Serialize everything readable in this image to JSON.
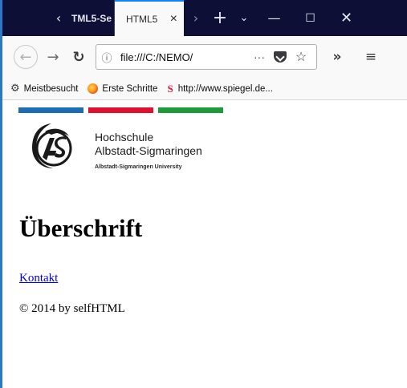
{
  "browser": {
    "tabs": [
      {
        "title": "TML5-Se",
        "active": false
      },
      {
        "title": "HTML5",
        "active": true
      }
    ],
    "url": "file:///C:/NEMO/",
    "bookmarks": [
      {
        "label": "Meistbesucht",
        "icon": "gear-icon"
      },
      {
        "label": "Erste Schritte",
        "icon": "firefox-icon"
      },
      {
        "label": "http://www.spiegel.de...",
        "icon": "spiegel-icon"
      }
    ],
    "icons": {
      "tab_scroll_left": "‹",
      "tab_scroll_right": "›",
      "new_tab": "+",
      "tab_list": "⌄",
      "close_tab": "×",
      "minimize": "—",
      "maximize": "☐",
      "close_window": "✕",
      "back": "←",
      "forward": "→",
      "reload": "↻",
      "page_actions": "···",
      "star": "☆",
      "overflow": "»",
      "menu": "≡",
      "info": "ⓘ",
      "gear": "⚙",
      "spiegel": "S"
    }
  },
  "page": {
    "stripe_colors": [
      "#1b6cb5",
      "#e0102f",
      "#1e9a3a"
    ],
    "logo": {
      "line1": "Hochschule",
      "line2": "Albstadt-Sigmaringen",
      "line3": "Albstadt-Sigmaringen University"
    },
    "heading": "Überschrift",
    "link": "Kontakt",
    "footer": "© 2014 by selfHTML"
  }
}
